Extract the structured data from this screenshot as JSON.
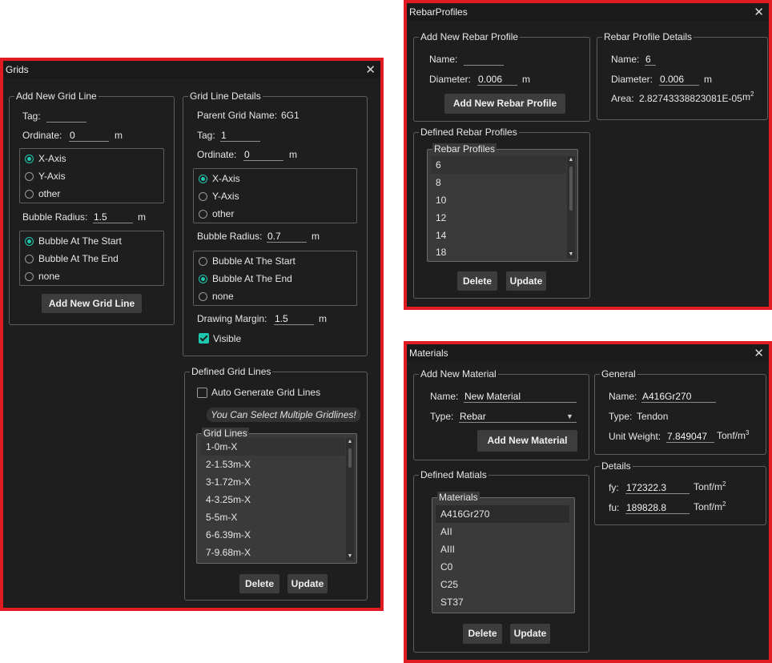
{
  "grids": {
    "title": "Grids",
    "add_new": {
      "legend": "Add New Grid Line",
      "tag_label": "Tag:",
      "tag_value": "",
      "ordinate_label": "Ordinate:",
      "ordinate_value": "0",
      "ordinate_unit": "m",
      "axis_options": [
        "X-Axis",
        "Y-Axis",
        "other"
      ],
      "axis_selected": "X-Axis",
      "bubble_radius_label": "Bubble Radius:",
      "bubble_radius_value": "1.5",
      "bubble_radius_unit": "m",
      "bubble_options": [
        "Bubble At The Start",
        "Bubble At The End",
        "none"
      ],
      "bubble_selected": "Bubble At The Start",
      "button": "Add New Grid Line"
    },
    "details": {
      "legend": "Grid Line Details",
      "parent_label": "Parent Grid Name:",
      "parent_value": "6G1",
      "tag_label": "Tag:",
      "tag_value": "1",
      "ordinate_label": "Ordinate:",
      "ordinate_value": "0",
      "ordinate_unit": "m",
      "axis_options": [
        "X-Axis",
        "Y-Axis",
        "other"
      ],
      "axis_selected": "X-Axis",
      "bubble_radius_label": "Bubble Radius:",
      "bubble_radius_value": "0.7",
      "bubble_radius_unit": "m",
      "bubble_options": [
        "Bubble At The Start",
        "Bubble At The End",
        "none"
      ],
      "bubble_selected": "Bubble At The End",
      "margin_label": "Drawing Margin:",
      "margin_value": "1.5",
      "margin_unit": "m",
      "visible_label": "Visible",
      "visible_checked": true
    },
    "defined": {
      "legend": "Defined Grid Lines",
      "auto_label": "Auto Generate Grid Lines",
      "auto_checked": false,
      "hint": "You Can Select Multiple Gridlines!",
      "list_legend": "Grid Lines",
      "items": [
        "1-0m-X",
        "2-1.53m-X",
        "3-1.72m-X",
        "4-3.25m-X",
        "5-5m-X",
        "6-6.39m-X",
        "7-9.68m-X"
      ],
      "delete": "Delete",
      "update": "Update"
    }
  },
  "rebar": {
    "title": "RebarProfiles",
    "add_new": {
      "legend": "Add New Rebar Profile",
      "name_label": "Name:",
      "name_value": "",
      "diameter_label": "Diameter:",
      "diameter_value": "0.006",
      "diameter_unit": "m",
      "button": "Add New Rebar Profile"
    },
    "details": {
      "legend": "Rebar Profile Details",
      "name_label": "Name:",
      "name_value": "6",
      "diameter_label": "Diameter:",
      "diameter_value": "0.006",
      "diameter_unit": "m",
      "area_label": "Area:",
      "area_value": "2.82743338823081E-05",
      "area_unit": "m",
      "area_exp": "2"
    },
    "defined": {
      "legend": "Defined Rebar Profiles",
      "list_legend": "Rebar Profiles",
      "items": [
        "6",
        "8",
        "10",
        "12",
        "14",
        "18"
      ],
      "delete": "Delete",
      "update": "Update"
    }
  },
  "materials": {
    "title": "Materials",
    "add_new": {
      "legend": "Add New Material",
      "name_label": "Name:",
      "name_value": "New Material",
      "type_label": "Type:",
      "type_value": "Rebar",
      "button": "Add New Material"
    },
    "general": {
      "legend": "General",
      "name_label": "Name:",
      "name_value": "A416Gr270",
      "type_label": "Type:",
      "type_value": "Tendon",
      "weight_label": "Unit Weight:",
      "weight_value": "7.849047",
      "weight_unit": "Tonf/m",
      "weight_exp": "3"
    },
    "details": {
      "legend": "Details",
      "fy_label": "fy:",
      "fy_value": "172322.3",
      "fy_unit": "Tonf/m",
      "fu_label": "fu:",
      "fu_value": "189828.8",
      "fu_unit": "Tonf/m",
      "unit_exp": "2"
    },
    "defined": {
      "legend": "Defined Matials",
      "list_legend": "Materials",
      "items": [
        "A416Gr270",
        "AII",
        "AIII",
        "C0",
        "C25",
        "ST37"
      ],
      "delete": "Delete",
      "update": "Update"
    }
  },
  "colors": {
    "accent": "#1ec8b0",
    "frame": "#e11b22",
    "panel": "#1e1e1e"
  }
}
